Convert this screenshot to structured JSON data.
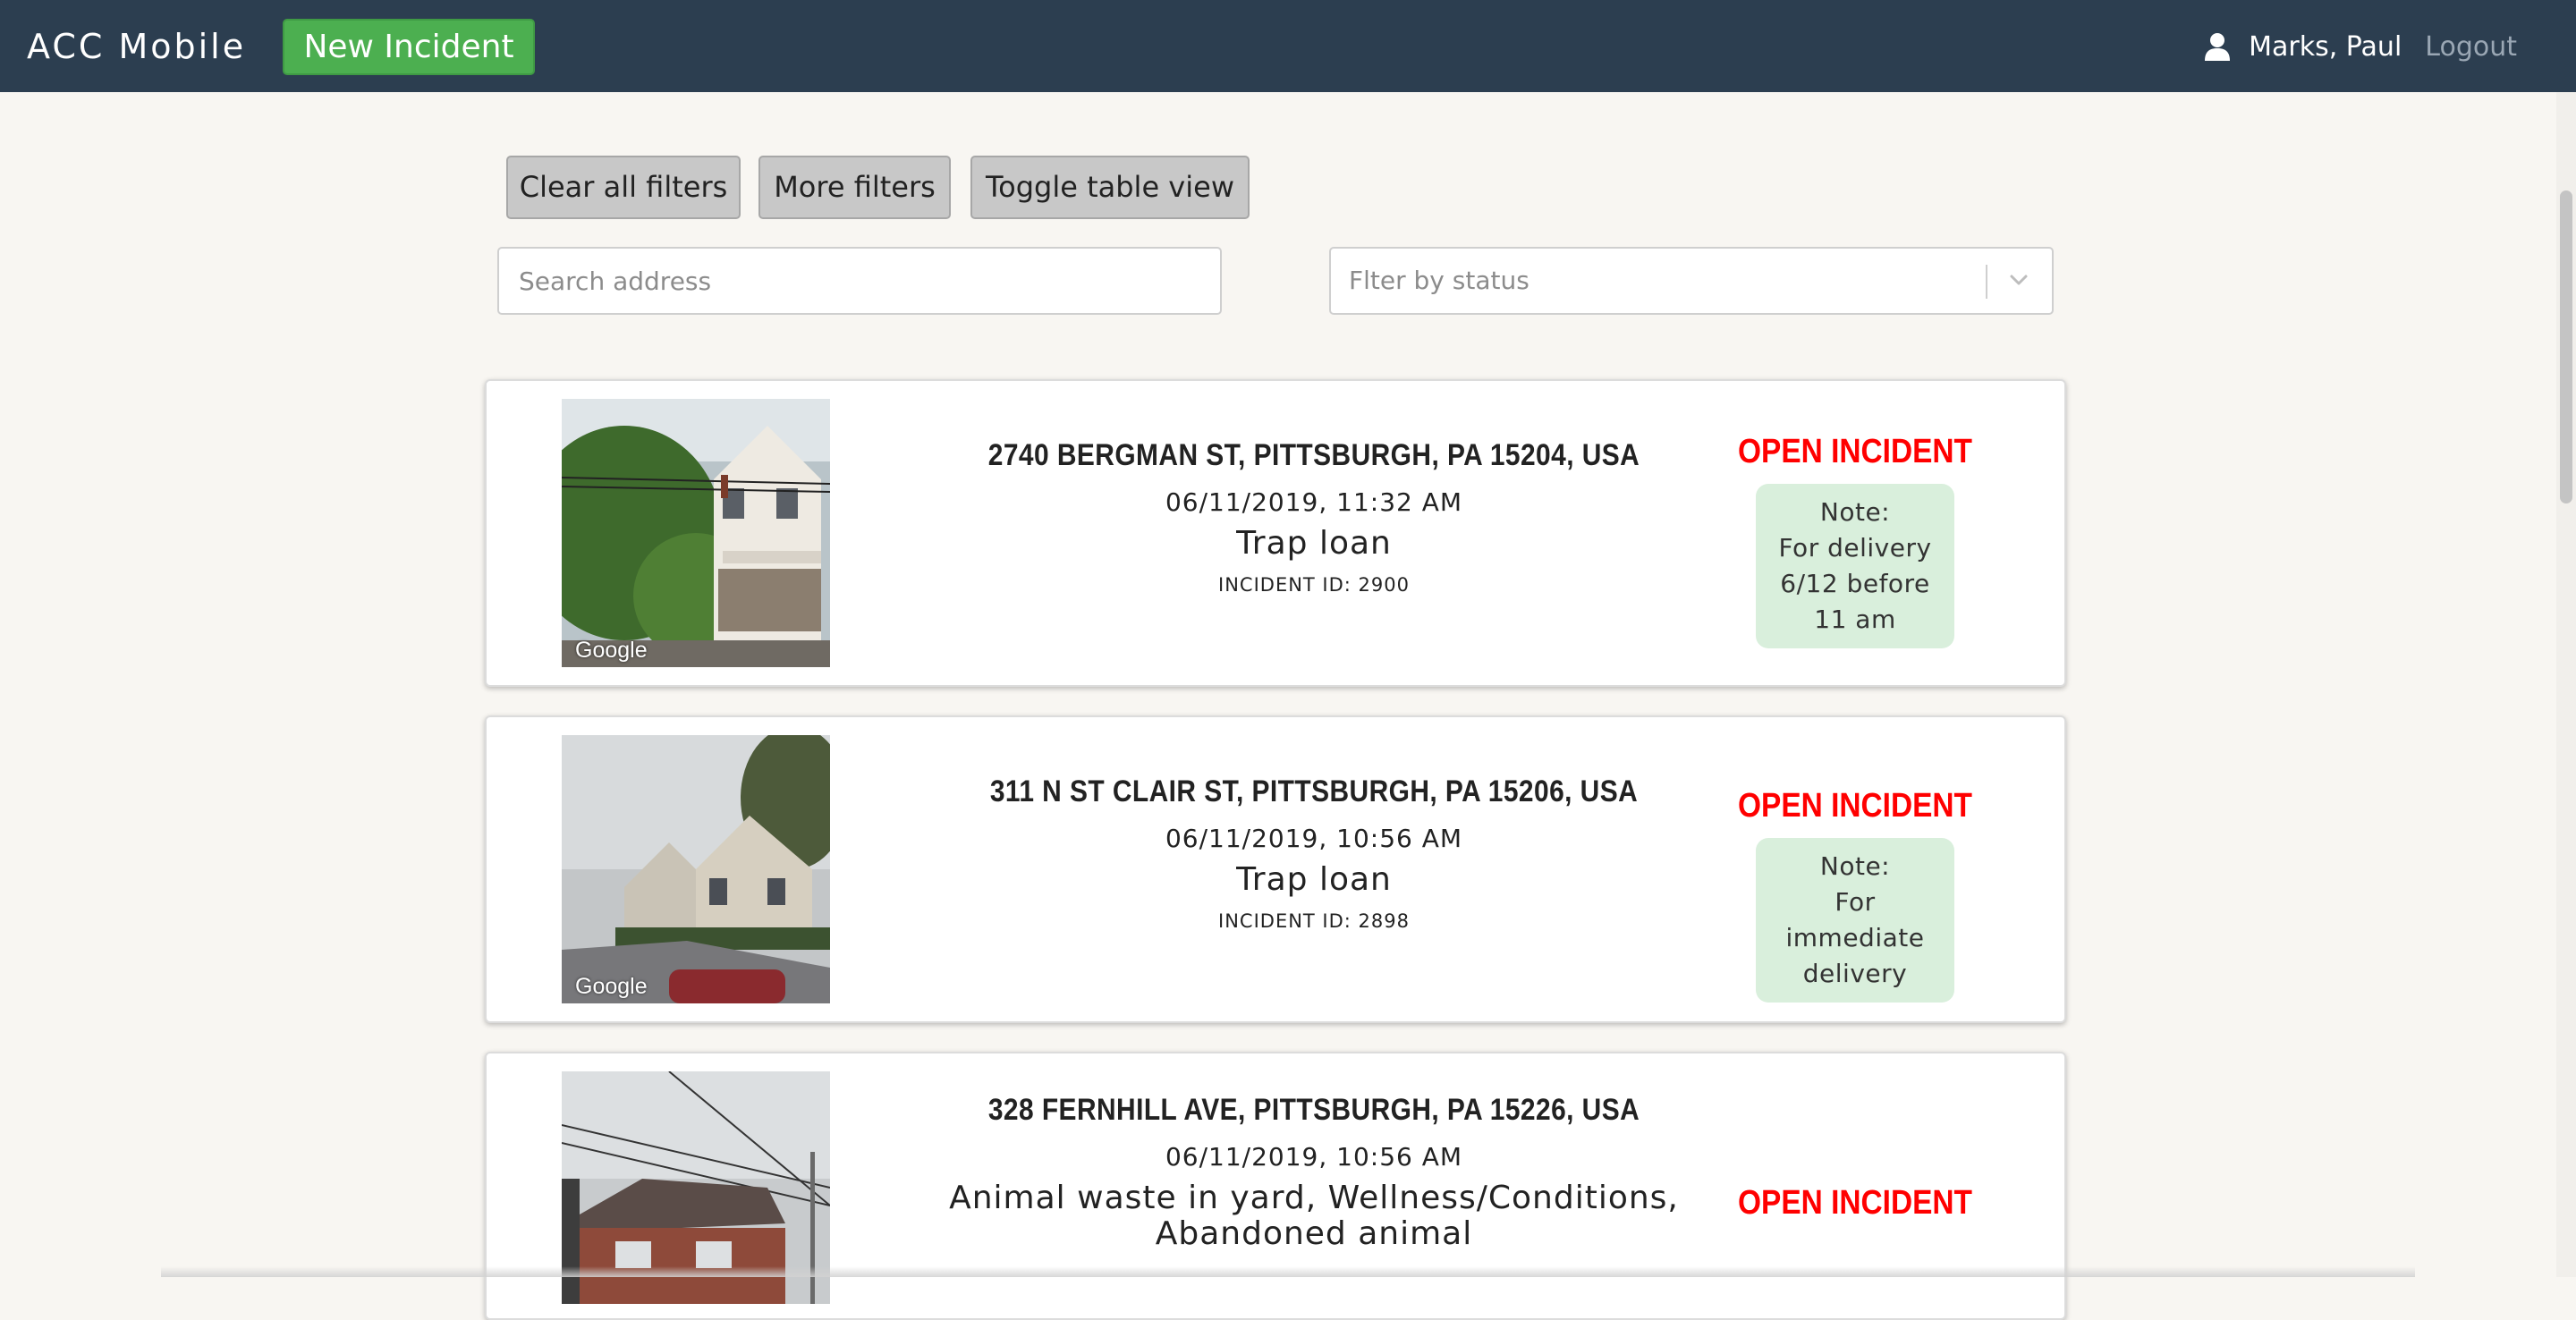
{
  "app": {
    "brand": "ACC Mobile",
    "new_incident_label": "New Incident",
    "user_name": "Marks, Paul",
    "logout_label": "Logout"
  },
  "filters": {
    "clear_label": "Clear all filters",
    "more_label": "More filters",
    "toggle_label": "Toggle table view",
    "search_placeholder": "Search address",
    "status_placeholder": "Flter by status"
  },
  "incidents": [
    {
      "address": "2740 BERGMAN ST, PITTSBURGH, PA 15204, USA",
      "datetime": "06/11/2019, 11:32 AM",
      "type": "Trap loan",
      "incident_id_text": "INCIDENT ID: 2900",
      "status": "OPEN INCIDENT",
      "note_label": "Note:",
      "note_text": "For delivery 6/12 before 11 am",
      "image_credit": "Google"
    },
    {
      "address": "311 N ST CLAIR ST, PITTSBURGH, PA 15206, USA",
      "datetime": "06/11/2019, 10:56 AM",
      "type": "Trap loan",
      "incident_id_text": "INCIDENT ID: 2898",
      "status": "OPEN INCIDENT",
      "note_label": "Note:",
      "note_text": "For immediate delivery",
      "image_credit": "Google"
    },
    {
      "address": "328 FERNHILL AVE, PITTSBURGH, PA 15226, USA",
      "datetime": "06/11/2019, 10:56 AM",
      "type": "Animal waste in yard, Wellness/Conditions, Abandoned animal",
      "status": "OPEN INCIDENT"
    }
  ],
  "icons": {
    "user": "user-icon",
    "dropdown": "chevron-down-icon"
  },
  "colors": {
    "navbar": "#2c3e50",
    "primary_button": "#4caf50",
    "status_open": "#ff0000",
    "note_bg": "#d9efdc"
  }
}
